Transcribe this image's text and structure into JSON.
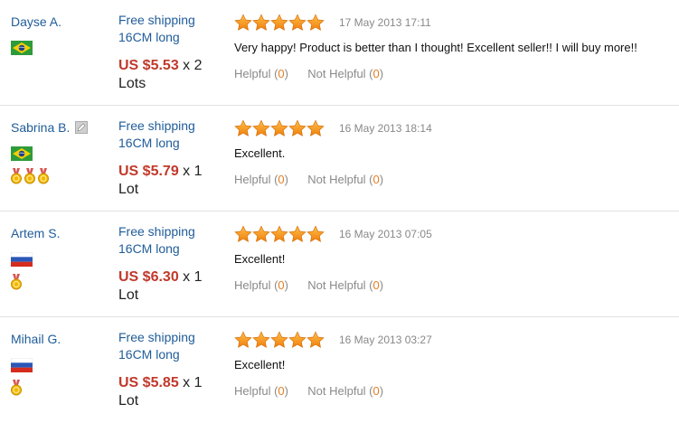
{
  "labels": {
    "helpful": "Helpful",
    "not_helpful": "Not Helpful"
  },
  "colors": {
    "link": "#1f5c99",
    "price": "#c0392b",
    "star": "#f39c12",
    "count": "#e67e22"
  },
  "reviews": [
    {
      "buyer": "Dayse A.",
      "flag": "brazil-flag",
      "edit_icon": false,
      "medals": 0,
      "shipping": "Free shipping",
      "spec": "16CM long",
      "price": "US $5.53",
      "qty": " x 2",
      "unit": "Lots",
      "rating": 5,
      "date": "17 May 2013 17:11",
      "text": "Very happy! Product is better than I thought! Excellent seller!! I will buy more!!",
      "helpful": "0",
      "not_helpful": "0"
    },
    {
      "buyer": "Sabrina B.",
      "flag": "brazil-flag",
      "edit_icon": true,
      "medals": 3,
      "shipping": "Free shipping",
      "spec": "16CM long",
      "price": "US $5.79",
      "qty": " x 1",
      "unit": "Lot",
      "rating": 5,
      "date": "16 May 2013 18:14",
      "text": "Excellent.",
      "helpful": "0",
      "not_helpful": "0"
    },
    {
      "buyer": "Artem S.",
      "flag": "russia-flag",
      "edit_icon": false,
      "medals": 1,
      "shipping": "Free shipping",
      "spec": "16CM long",
      "price": "US $6.30",
      "qty": " x 1",
      "unit": "Lot",
      "rating": 5,
      "date": "16 May 2013 07:05",
      "text": "Excellent!",
      "helpful": "0",
      "not_helpful": "0"
    },
    {
      "buyer": "Mihail G.",
      "flag": "russia-flag",
      "edit_icon": false,
      "medals": 1,
      "shipping": "Free shipping",
      "spec": "16CM long",
      "price": "US $5.85",
      "qty": " x 1",
      "unit": "Lot",
      "rating": 5,
      "date": "16 May 2013 03:27",
      "text": "Excellent!",
      "helpful": "0",
      "not_helpful": "0"
    }
  ]
}
